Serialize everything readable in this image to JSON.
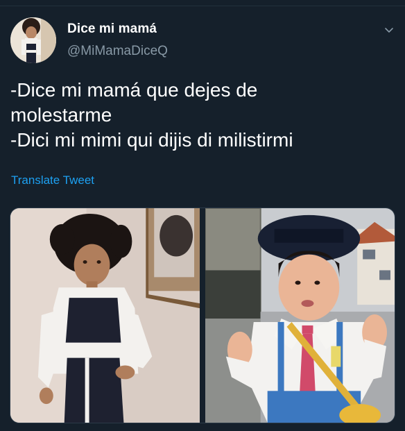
{
  "author": {
    "display_name": "Dice mi mamá",
    "handle": "@MiMamaDiceQ"
  },
  "tweet": {
    "text": "-Dice mi mamá que dejes de\nmolestarme\n-Dici mi mimi qui dijis di milistirmi",
    "translate_label": "Translate Tweet"
  },
  "icons": {
    "more": "chevron-down-icon"
  },
  "colors": {
    "background": "#15202b",
    "secondary_text": "#8899a6",
    "link": "#1da1f2"
  }
}
